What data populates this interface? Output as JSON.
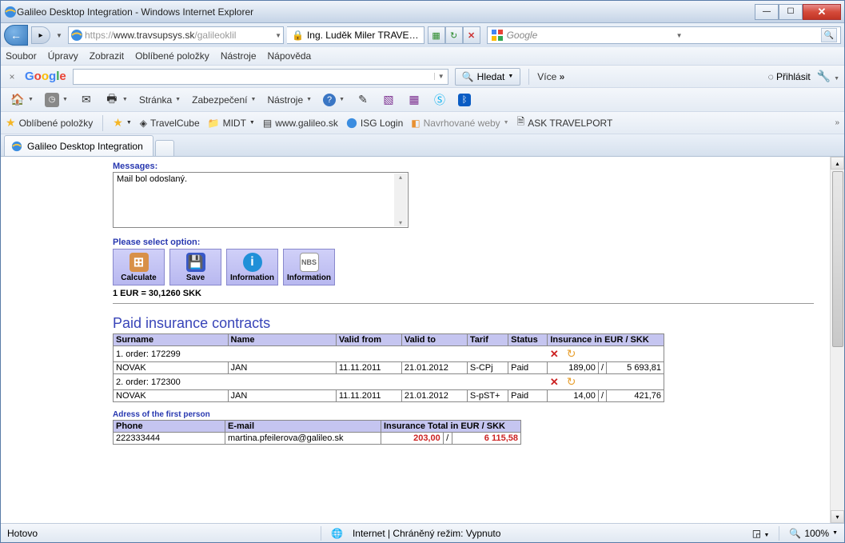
{
  "window": {
    "title": "Galileo Desktop Integration - Windows Internet Explorer"
  },
  "address": {
    "scheme": "https://",
    "host": "www.travsupsys.sk",
    "path": "/galileoklil",
    "cert": "Ing. Luděk Miler TRAVE…"
  },
  "search": {
    "placeholder": "Google"
  },
  "menus": {
    "m0": "Soubor",
    "m1": "Úpravy",
    "m2": "Zobrazit",
    "m3": "Oblíbené položky",
    "m4": "Nástroje",
    "m5": "Nápověda"
  },
  "gtoolbar": {
    "hledat": "Hledat",
    "vice": "Více",
    "login": "Přihlásit"
  },
  "cmdbar": {
    "stranka": "Stránka",
    "zabez": "Zabezpečení",
    "nastroje": "Nástroje"
  },
  "favs": {
    "fav0": "Oblíbené položky",
    "fav1": "TravelCube",
    "fav2": "MIDT",
    "fav3": "www.galileo.sk",
    "fav4": "ISG Login",
    "fav5": "Navrhované weby",
    "fav6": "ASK TRAVELPORT"
  },
  "tab": {
    "title": "Galileo Desktop Integration"
  },
  "page": {
    "msg_label": "Messages:",
    "msg_text": "Mail bol odoslaný.",
    "opt_label": "Please select option:",
    "btn0": "Calculate",
    "btn1": "Save",
    "btn2": "Information",
    "btn3": "Information",
    "rate": "1 EUR = 30,1260 SKK",
    "section_h": "Paid insurance contracts",
    "th0": "Surname",
    "th1": "Name",
    "th2": "Valid from",
    "th3": "Valid to",
    "th4": "Tarif",
    "th5": "Status",
    "th6": "Insurance in EUR / SKK",
    "order1": "1. order: 172299",
    "r1_surname": "NOVAK",
    "r1_name": "JAN",
    "r1_from": "11.11.2011",
    "r1_to": "21.01.2012",
    "r1_tarif": "S-CPj",
    "r1_status": "Paid",
    "r1_eur": "189,00",
    "r1_skk": "5 693,81",
    "order2": "2. order: 172300",
    "r2_surname": "NOVAK",
    "r2_name": "JAN",
    "r2_from": "11.11.2011",
    "r2_to": "21.01.2012",
    "r2_tarif": "S-pST+",
    "r2_status": "Paid",
    "r2_eur": "14,00",
    "r2_skk": "421,76",
    "addr_label": "Adress of the first person",
    "a_th0": "Phone",
    "a_th1": "E-mail",
    "a_th2": "Insurance Total in EUR / SKK",
    "a_phone": "222333444",
    "a_email": "martina.pfeilerova@galileo.sk",
    "a_tot_eur": "203,00",
    "a_tot_skk": "6 115,58",
    "slash": "/"
  },
  "status": {
    "left": "Hotovo",
    "zone": "Internet | Chráněný režim: Vypnuto",
    "zoom": "100%"
  }
}
